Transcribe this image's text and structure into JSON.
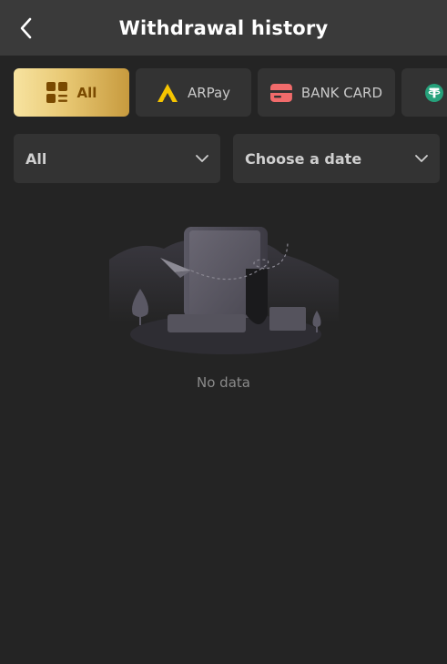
{
  "header": {
    "title": "Withdrawal history",
    "back_icon": "chevron-left-icon"
  },
  "tabs": [
    {
      "label": "All",
      "icon": "grid-list-icon",
      "active": true
    },
    {
      "label": "ARPay",
      "icon": "arpay-logo-icon",
      "active": false
    },
    {
      "label": "BANK CARD",
      "icon": "bank-card-icon",
      "active": false
    },
    {
      "label": "",
      "icon": "usdt-icon",
      "active": false
    }
  ],
  "filters": {
    "type": {
      "value": "All",
      "icon": "chevron-down-icon"
    },
    "date": {
      "value": "Choose a date",
      "icon": "chevron-down-icon"
    }
  },
  "empty_state": {
    "message": "No data",
    "illustration": "empty-document-illustration"
  },
  "colors": {
    "background": "#242424",
    "header": "#3a3a3a",
    "card": "#333333",
    "accent_gold": "#e8c873",
    "accent_text": "#7a4a00",
    "arpay_yellow": "#f5c400",
    "bank_red": "#f16b6b",
    "usdt_green": "#26a17b"
  }
}
